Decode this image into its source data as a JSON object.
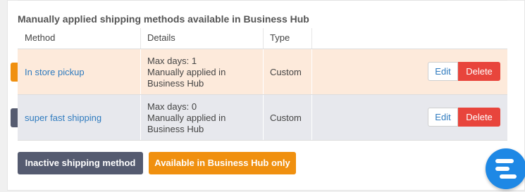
{
  "section": {
    "title": "Manually applied shipping methods available in Business Hub"
  },
  "table": {
    "headers": {
      "method": "Method",
      "details": "Details",
      "type": "Type"
    },
    "rows": [
      {
        "method": "In store pickup",
        "details_line1": "Max days: 1",
        "details_line2": "Manually applied in",
        "details_line3": "Business Hub",
        "type": "Custom",
        "edit": "Edit",
        "delete": "Delete",
        "status": "available-in-business-hub"
      },
      {
        "method": "super fast shipping",
        "details_line1": "Max days: 0",
        "details_line2": "Manually applied in",
        "details_line3": "Business Hub",
        "type": "Custom",
        "edit": "Edit",
        "delete": "Delete",
        "status": "inactive"
      }
    ]
  },
  "legend": {
    "inactive": "Inactive shipping method",
    "available": "Available in Business Hub only"
  },
  "colors": {
    "orange_marker": "#f0900f",
    "gray_marker": "#555b70",
    "delete_red": "#e8453c",
    "link_blue": "#2f7bbf",
    "fab_blue": "#1e88e5"
  },
  "fab": {
    "icon": "stacked-bars-icon"
  }
}
